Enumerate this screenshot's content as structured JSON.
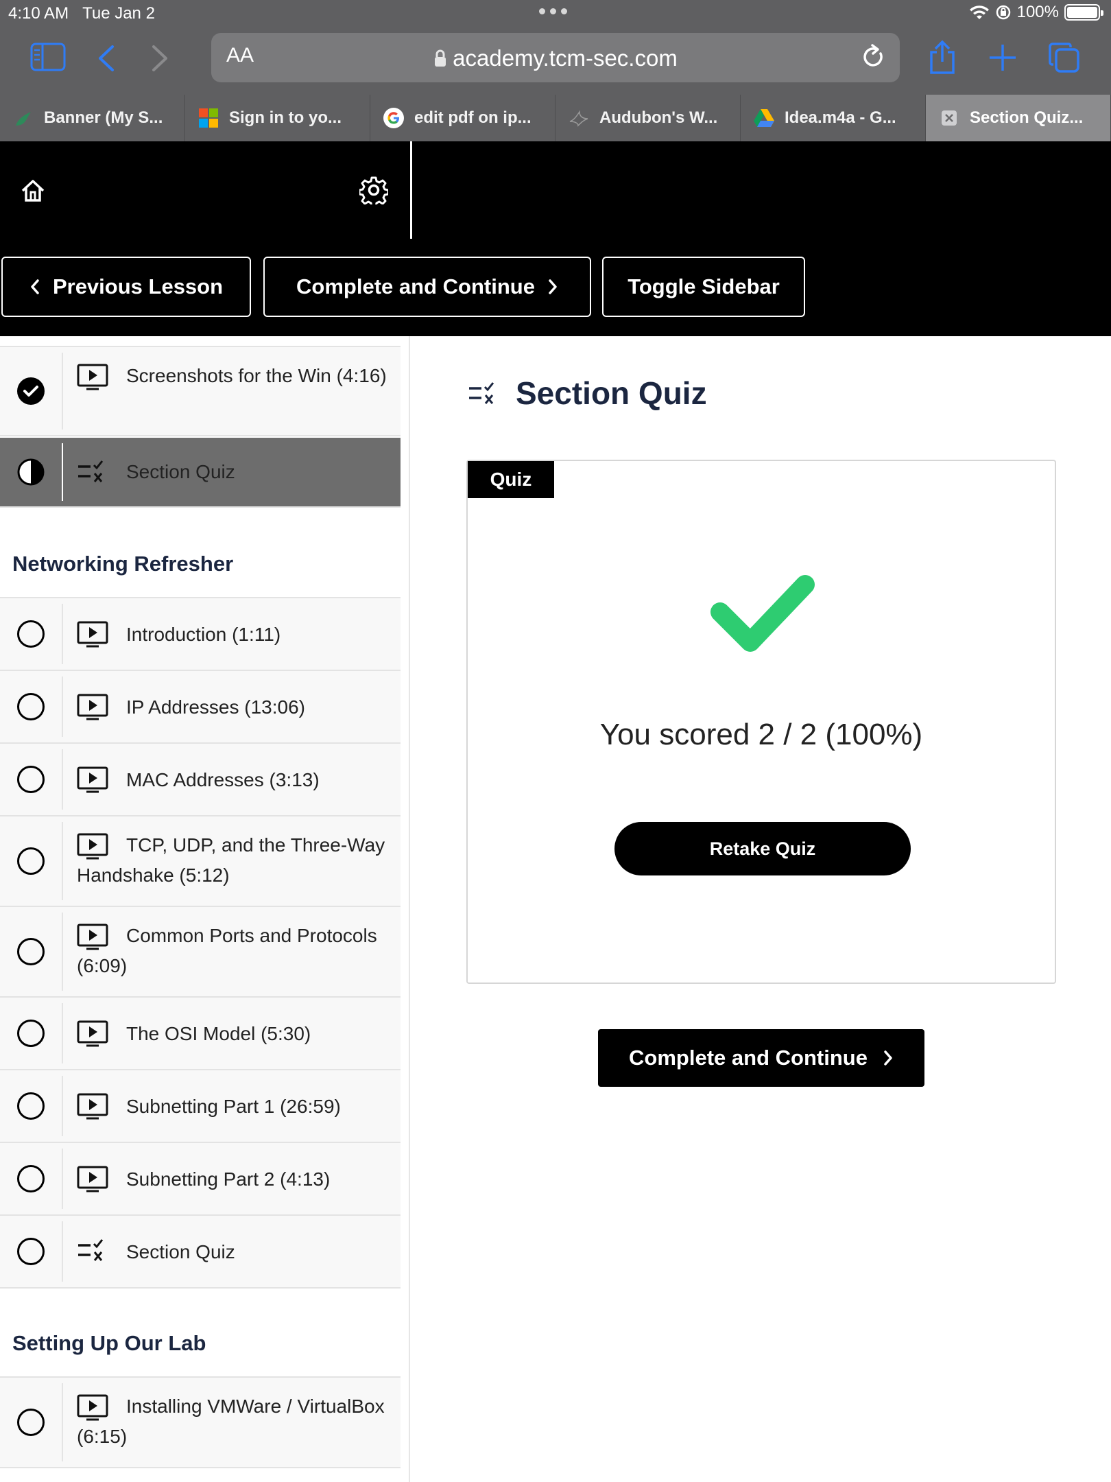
{
  "status_bar": {
    "time": "4:10 AM",
    "date": "Tue Jan 2",
    "battery": "100%"
  },
  "browser": {
    "aa": "AA",
    "url": "academy.tcm-sec.com",
    "tabs": [
      {
        "label": "Banner (My S...",
        "icon": "stag-logo"
      },
      {
        "label": "Sign in to yo...",
        "icon": "microsoft-logo"
      },
      {
        "label": "edit pdf on ip...",
        "icon": "google-logo"
      },
      {
        "label": "Audubon's W...",
        "icon": "bird-icon"
      },
      {
        "label": "Idea.m4a - G...",
        "icon": "drive-logo"
      },
      {
        "label": "Section Quiz...",
        "icon": "close-tab-icon"
      }
    ]
  },
  "course_nav": {
    "previous": "Previous Lesson",
    "complete": "Complete and Continue",
    "toggle": "Toggle Sidebar"
  },
  "sidebar": {
    "lessons_top": [
      {
        "title": "Screenshots for the Win (4:16)",
        "status": "complete",
        "type": "video"
      },
      {
        "title": "Section Quiz",
        "status": "in-progress",
        "type": "quiz"
      }
    ],
    "sections": [
      {
        "title": "Networking Refresher",
        "lessons": [
          {
            "title": "Introduction (1:11)",
            "type": "video"
          },
          {
            "title": "IP Addresses (13:06)",
            "type": "video"
          },
          {
            "title": "MAC Addresses (3:13)",
            "type": "video"
          },
          {
            "title": "TCP, UDP, and the Three-Way Handshake (5:12)",
            "type": "video"
          },
          {
            "title": "Common Ports and Protocols (6:09)",
            "type": "video"
          },
          {
            "title": "The OSI Model (5:30)",
            "type": "video"
          },
          {
            "title": "Subnetting Part 1 (26:59)",
            "type": "video"
          },
          {
            "title": "Subnetting Part 2 (4:13)",
            "type": "video"
          },
          {
            "title": "Section Quiz",
            "type": "quiz"
          }
        ]
      },
      {
        "title": "Setting Up Our Lab",
        "lessons": [
          {
            "title": "Installing VMWare / VirtualBox (6:15)",
            "type": "video"
          }
        ]
      }
    ]
  },
  "main": {
    "title": "Section Quiz",
    "tag": "Quiz",
    "score": "You scored 2 / 2 (100%)",
    "retake": "Retake Quiz",
    "cta": "Complete and Continue"
  },
  "colors": {
    "chrome": "#5f5f61",
    "accent_blue": "#2f7cf6",
    "success": "#2ecc71",
    "heading": "#1b2640"
  }
}
